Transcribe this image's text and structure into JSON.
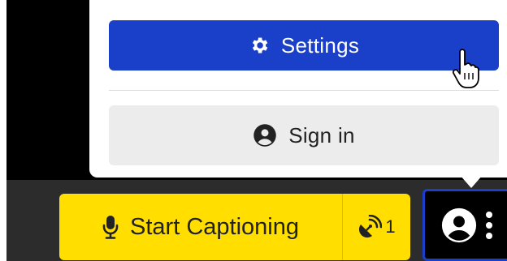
{
  "menu": {
    "settings_label": "Settings",
    "signin_label": "Sign in"
  },
  "toolbar": {
    "start_captioning_label": "Start Captioning",
    "broadcast_count": "1"
  },
  "icons": {
    "settings": "gear-icon",
    "signin": "user-circle-icon",
    "mic": "microphone-icon",
    "broadcast": "satellite-dish-icon",
    "profile": "user-circle-icon",
    "more": "more-vertical-icon",
    "cursor": "hand-pointer-cursor"
  },
  "colors": {
    "accent_blue": "#1a3fc9",
    "caption_yellow": "#ffde00",
    "bar_dark": "#2c2c2c",
    "video_black": "#000000",
    "signin_grey": "#ececec"
  }
}
